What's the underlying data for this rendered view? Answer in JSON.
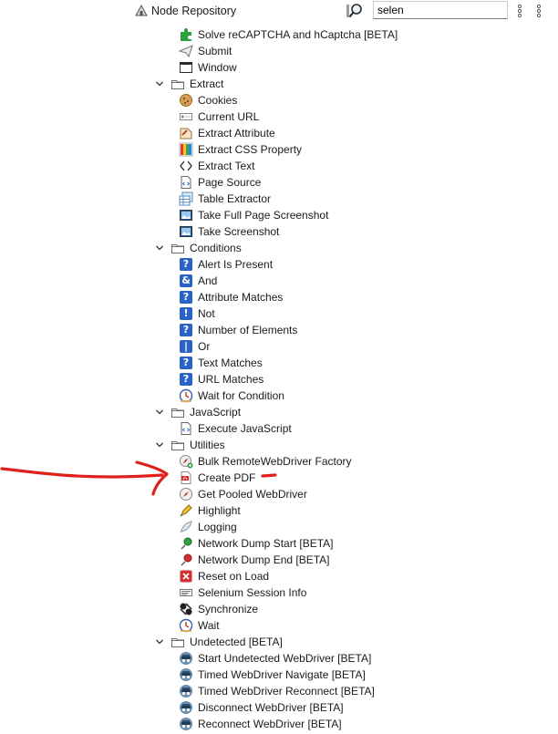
{
  "header": {
    "title": "Node Repository",
    "search_value": "selen"
  },
  "tree": [
    {
      "type": "item",
      "label": "Solve reCAPTCHA and hCaptcha [BETA]",
      "icon": "puzzle-icon"
    },
    {
      "type": "item",
      "label": "Submit",
      "icon": "paper-plane-icon"
    },
    {
      "type": "item",
      "label": "Window",
      "icon": "window-icon"
    },
    {
      "type": "category",
      "label": "Extract",
      "icon": "folder-icon"
    },
    {
      "type": "item",
      "label": "Cookies",
      "icon": "cookie-icon"
    },
    {
      "type": "item",
      "label": "Current URL",
      "icon": "url-field-icon"
    },
    {
      "type": "item",
      "label": "Extract Attribute",
      "icon": "attribute-icon"
    },
    {
      "type": "item",
      "label": "Extract CSS Property",
      "icon": "css-palette-icon"
    },
    {
      "type": "item",
      "label": "Extract Text",
      "icon": "code-brackets-icon"
    },
    {
      "type": "item",
      "label": "Page Source",
      "icon": "page-source-icon"
    },
    {
      "type": "item",
      "label": "Table Extractor",
      "icon": "table-icon"
    },
    {
      "type": "item",
      "label": "Take Full Page Screenshot",
      "icon": "screenshot-icon"
    },
    {
      "type": "item",
      "label": "Take Screenshot",
      "icon": "screenshot-icon"
    },
    {
      "type": "category",
      "label": "Conditions",
      "icon": "folder-icon"
    },
    {
      "type": "item",
      "label": "Alert Is Present",
      "icon": "question-icon",
      "glyph": "?"
    },
    {
      "type": "item",
      "label": "And",
      "icon": "and-icon",
      "glyph": "&"
    },
    {
      "type": "item",
      "label": "Attribute Matches",
      "icon": "question-icon",
      "glyph": "?"
    },
    {
      "type": "item",
      "label": "Not",
      "icon": "not-icon",
      "glyph": "!"
    },
    {
      "type": "item",
      "label": "Number of Elements",
      "icon": "question-icon",
      "glyph": "?"
    },
    {
      "type": "item",
      "label": "Or",
      "icon": "or-icon",
      "glyph": "|"
    },
    {
      "type": "item",
      "label": "Text Matches",
      "icon": "question-icon",
      "glyph": "?"
    },
    {
      "type": "item",
      "label": "URL Matches",
      "icon": "question-icon",
      "glyph": "?"
    },
    {
      "type": "item",
      "label": "Wait for Condition",
      "icon": "clock-icon"
    },
    {
      "type": "category",
      "label": "JavaScript",
      "icon": "folder-icon"
    },
    {
      "type": "item",
      "label": "Execute JavaScript",
      "icon": "page-source-icon"
    },
    {
      "type": "category",
      "label": "Utilities",
      "icon": "folder-icon"
    },
    {
      "type": "item",
      "label": "Bulk RemoteWebDriver Factory",
      "icon": "compass-add-icon"
    },
    {
      "type": "item",
      "label": "Create PDF",
      "icon": "pdf-icon"
    },
    {
      "type": "item",
      "label": "Get Pooled WebDriver",
      "icon": "compass-icon"
    },
    {
      "type": "item",
      "label": "Highlight",
      "icon": "highlighter-icon"
    },
    {
      "type": "item",
      "label": "Logging",
      "icon": "feather-icon"
    },
    {
      "type": "item",
      "label": "Network Dump Start [BETA]",
      "icon": "green-pin-icon"
    },
    {
      "type": "item",
      "label": "Network Dump End [BETA]",
      "icon": "red-pin-icon"
    },
    {
      "type": "item",
      "label": "Reset on Load",
      "icon": "red-x-icon"
    },
    {
      "type": "item",
      "label": "Selenium Session Info",
      "icon": "session-info-icon"
    },
    {
      "type": "item",
      "label": "Synchronize",
      "icon": "sync-icon"
    },
    {
      "type": "item",
      "label": "Wait",
      "icon": "clock-icon"
    },
    {
      "type": "category",
      "label": "Undetected [BETA]",
      "icon": "folder-icon"
    },
    {
      "type": "item",
      "label": "Start Undetected WebDriver [BETA]",
      "icon": "incognito-icon"
    },
    {
      "type": "item",
      "label": "Timed WebDriver Navigate [BETA]",
      "icon": "incognito-icon"
    },
    {
      "type": "item",
      "label": "Timed WebDriver Reconnect [BETA]",
      "icon": "incognito-icon"
    },
    {
      "type": "item",
      "label": "Disconnect WebDriver [BETA]",
      "icon": "incognito-icon"
    },
    {
      "type": "item",
      "label": "Reconnect WebDriver [BETA]",
      "icon": "incognito-icon"
    }
  ],
  "colors": {
    "annotation": "#e0201b",
    "folder_stroke": "#6b6b6b",
    "condition_blue": "#2a62c9"
  }
}
